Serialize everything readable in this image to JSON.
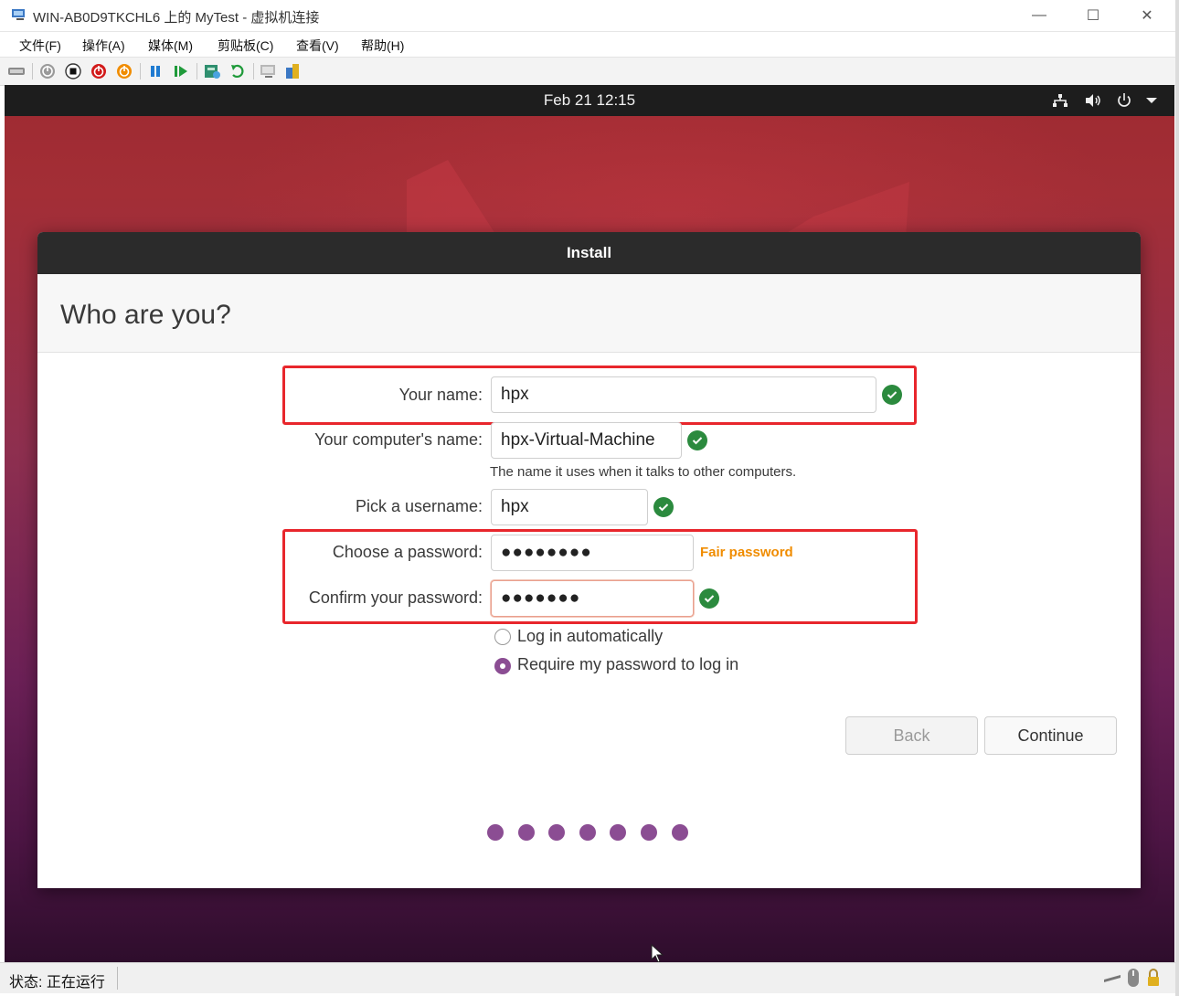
{
  "window": {
    "title": "WIN-AB0D9TKCHL6 上的 MyTest - 虚拟机连接",
    "minimize": "—",
    "maximize": "☐",
    "close": "✕"
  },
  "menubar": {
    "items": [
      "文件(F)",
      "操作(A)",
      "媒体(M)",
      "剪贴板(C)",
      "查看(V)",
      "帮助(H)"
    ]
  },
  "toolbar": {
    "icons": [
      "ctrl-alt-del-icon",
      "start-icon",
      "turn-off-icon",
      "shut-down-icon",
      "save-icon",
      "pause-icon",
      "resume-icon",
      "checkpoint-icon",
      "revert-icon",
      "enhanced-session-icon",
      "zoom-icon"
    ]
  },
  "guest": {
    "clock": "Feb 21  12:15",
    "top_icons": [
      "network-icon",
      "volume-icon",
      "power-icon",
      "menu-arrow-icon"
    ]
  },
  "installer": {
    "window_title": "Install",
    "heading": "Who are you?",
    "fields": {
      "your_name_label": "Your name:",
      "your_name_value": "hpx",
      "computer_name_label": "Your computer's name:",
      "computer_name_value": "hpx-Virtual-Machine",
      "computer_name_hint": "The name it uses when it talks to other computers.",
      "username_label": "Pick a username:",
      "username_value": "hpx",
      "password_label": "Choose a password:",
      "password_value": "●●●●●●●●",
      "password_strength": "Fair password",
      "confirm_label": "Confirm your password:",
      "confirm_value": "●●●●●●●"
    },
    "login_options": {
      "auto_login": "Log in automatically",
      "require_password": "Require my password to log in",
      "selected": "require_password"
    },
    "buttons": {
      "back": "Back",
      "continue": "Continue"
    },
    "progress": {
      "total_steps": 7
    },
    "accent_color": "#8b4d93",
    "highlight_color": "#e8262c"
  },
  "statusbar": {
    "status": "状态: 正在运行"
  }
}
